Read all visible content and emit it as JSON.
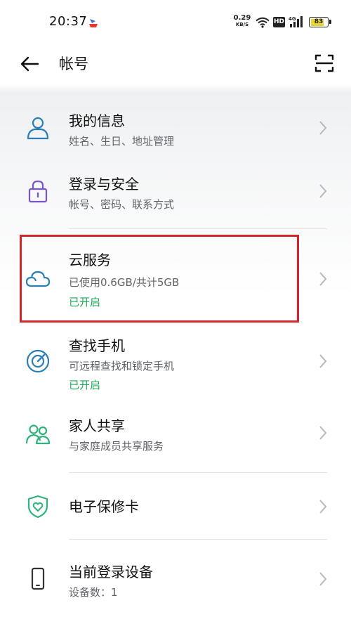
{
  "status_bar": {
    "time": "20:37",
    "net_speed_value": "0.29",
    "net_speed_unit": "KB/S",
    "hd_label": "HD",
    "signal_label": "4G",
    "battery_level": "83"
  },
  "header": {
    "title": "帐号",
    "back_icon": "arrow-left-icon",
    "scan_icon": "scan-icon"
  },
  "items": [
    {
      "title": "我的信息",
      "subtitle": "姓名、生日、地址管理",
      "status": "",
      "icon": "person-icon"
    },
    {
      "title": "登录与安全",
      "subtitle": "帐号、密码、联系方式",
      "status": "",
      "icon": "lock-icon"
    },
    {
      "title": "云服务",
      "subtitle": "已使用0.6GB/共计5GB",
      "status": "已开启",
      "icon": "cloud-icon"
    },
    {
      "title": "查找手机",
      "subtitle": "可远程查找和锁定手机",
      "status": "已开启",
      "icon": "radar-icon"
    },
    {
      "title": "家人共享",
      "subtitle": "与家庭成员共享服务",
      "status": "",
      "icon": "family-icon"
    },
    {
      "title": "电子保修卡",
      "subtitle": "",
      "status": "",
      "icon": "shield-heart-icon"
    },
    {
      "title": "当前登录设备",
      "subtitle": "设备数：1",
      "status": "",
      "icon": "phone-icon"
    }
  ],
  "colors": {
    "status_on": "#1aaa55",
    "highlight_box": "#d4252a",
    "icon_blue": "#2b7fb5",
    "icon_purple": "#7a57c8",
    "icon_green": "#2fb37a"
  }
}
